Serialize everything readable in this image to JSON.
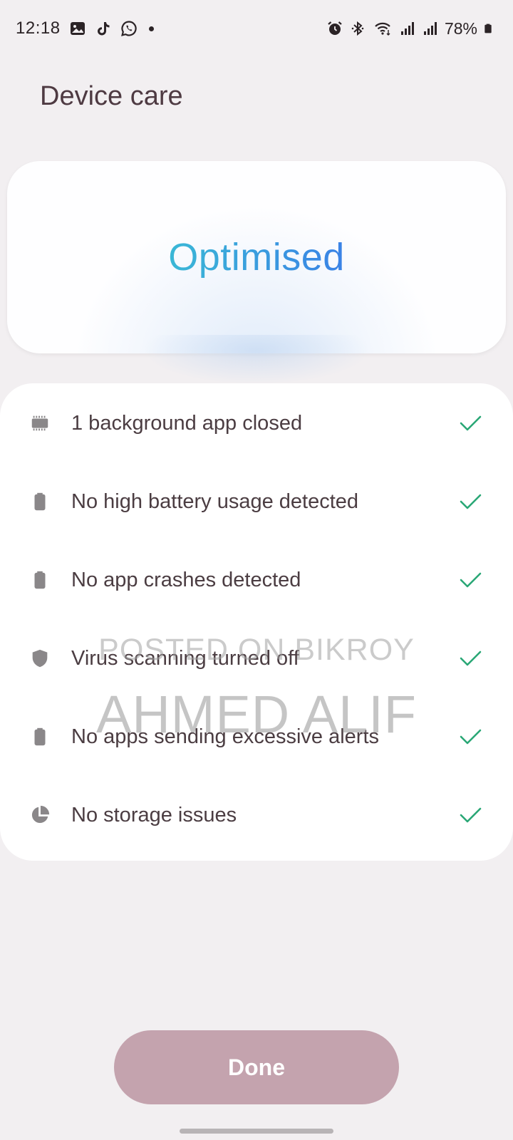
{
  "status_bar": {
    "time": "12:18",
    "battery_percent": "78%",
    "left_icons": [
      "gallery-icon",
      "tiktok-icon",
      "whatsapp-icon",
      "notification-dot"
    ],
    "right_icons": [
      "alarm-icon",
      "bluetooth-icon",
      "wifi-icon",
      "signal-icon",
      "signal-icon",
      "battery-icon"
    ]
  },
  "header": {
    "title": "Device care"
  },
  "status_card": {
    "status": "Optimised",
    "gradient_colors": [
      "#3ab8d6",
      "#3a82e6"
    ]
  },
  "checks": [
    {
      "icon": "memory-chip-icon",
      "label": "1 background app closed"
    },
    {
      "icon": "battery-icon",
      "label": "No high battery usage detected"
    },
    {
      "icon": "battery-icon",
      "label": "No app crashes detected"
    },
    {
      "icon": "shield-icon",
      "label": "Virus scanning turned off"
    },
    {
      "icon": "battery-icon",
      "label": "No apps sending excessive alerts"
    },
    {
      "icon": "storage-pie-icon",
      "label": "No storage issues"
    }
  ],
  "check_color": "#2aa776",
  "watermark": {
    "line1": "POSTED ON BIKROY",
    "line2": "AHMED ALIF"
  },
  "footer": {
    "done_label": "Done",
    "done_color": "#c4a3ae"
  }
}
